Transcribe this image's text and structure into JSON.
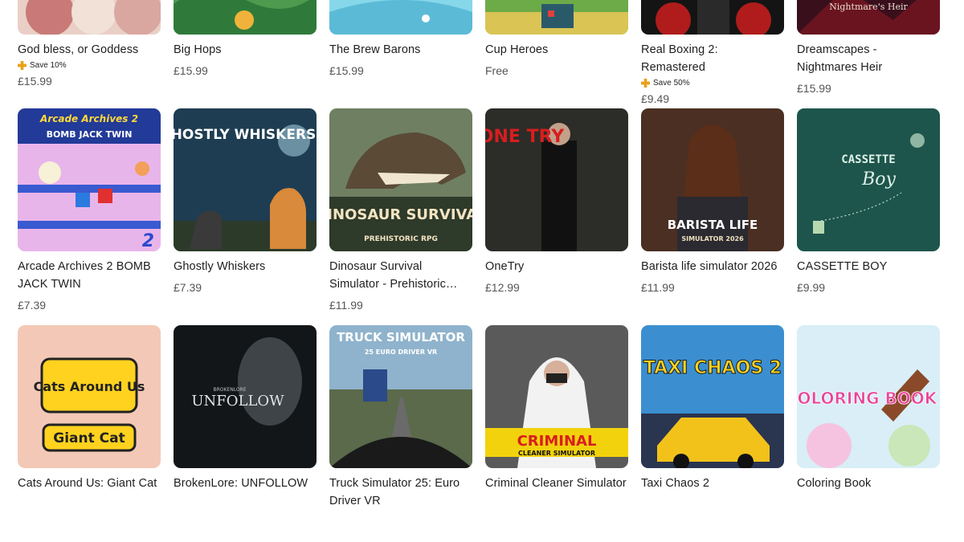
{
  "products": [
    {
      "title": "God bless, or Goddess",
      "promo": "Save 10%",
      "price": "£15.99",
      "art_colors": [
        "#e7c9c0",
        "#b86a6a"
      ]
    },
    {
      "title": "Big Hops",
      "price": "£15.99",
      "art_colors": [
        "#5aa85a",
        "#2f6fa7"
      ]
    },
    {
      "title": "The Brew Barons",
      "price": "£15.99",
      "art_colors": [
        "#7cd3e8",
        "#49b0cf"
      ]
    },
    {
      "title": "Cup Heroes",
      "price": "Free",
      "art_colors": [
        "#6ea84a",
        "#2f5a2a"
      ]
    },
    {
      "title": "Real Boxing 2: Remastered",
      "promo": "Save 50%",
      "price": "£9.49",
      "art_colors": [
        "#1a1a1a",
        "#a01818"
      ]
    },
    {
      "title": "Dreamscapes - Nightmares Heir",
      "price": "£15.99",
      "art_colors": [
        "#5a1010",
        "#2b0c2c"
      ],
      "art_text": "Nightmare's Heir"
    },
    {
      "title": "Arcade Archives 2 BOMB JACK TWIN",
      "price": "£7.39",
      "art_colors": [
        "#2a3f9a",
        "#e3a8e8"
      ],
      "art_text": "Arcade Archives 2",
      "art_subtext": "BOMB JACK TWIN"
    },
    {
      "title": "Ghostly Whiskers",
      "price": "£7.39",
      "art_colors": [
        "#23435a",
        "#0f2431"
      ],
      "art_text": "GHOSTLY WHISKERS"
    },
    {
      "title": "Dinosaur Survival Simulator - Prehistoric RPG",
      "price": "£11.99",
      "art_colors": [
        "#7a8a6a",
        "#3e4a3a"
      ],
      "art_text": "DINOSAUR SURVIVAL",
      "art_subtext": "PREHISTORIC RPG"
    },
    {
      "title": "OneTry",
      "price": "£12.99",
      "art_colors": [
        "#3a3a36",
        "#161614"
      ],
      "art_text": "ONE TRY"
    },
    {
      "title": "Barista life simulator 2026",
      "price": "£11.99",
      "art_colors": [
        "#5a3a2a",
        "#2a1a12"
      ],
      "art_text": "BARISTA LIFE",
      "art_subtext": "SIMULATOR 2026"
    },
    {
      "title": "CASSETTE BOY",
      "price": "£9.99",
      "art_colors": [
        "#1f5a52",
        "#17433d"
      ],
      "art_text": "CASSETTE",
      "art_subtext": "Boy"
    },
    {
      "title": "Cats Around Us: Giant Cat",
      "price": "",
      "art_colors": [
        "#f4c8b6",
        "#e9a88f"
      ],
      "art_text": "Cats Around Us",
      "art_subtext": "Giant Cat"
    },
    {
      "title": "BrokenLore: UNFOLLOW",
      "price": "",
      "art_colors": [
        "#2a2e30",
        "#0e1012"
      ],
      "art_text": "UNFOLLOW",
      "art_subtext": "BROKENLORE"
    },
    {
      "title": "Truck Simulator 25: Euro Driver VR",
      "price": "",
      "art_colors": [
        "#8fb3cc",
        "#3f4a52"
      ],
      "art_text": "TRUCK SIMULATOR",
      "art_subtext": "25 EURO DRIVER VR"
    },
    {
      "title": "Criminal Cleaner Simulator",
      "price": "",
      "art_colors": [
        "#6a6a6a",
        "#2a2a2a"
      ],
      "art_text": "CRIMINAL",
      "art_subtext": "CLEANER SIMULATOR"
    },
    {
      "title": "Taxi Chaos 2",
      "price": "",
      "art_colors": [
        "#4aa0d8",
        "#1d3a6a"
      ],
      "art_text": "TAXI CHAOS 2"
    },
    {
      "title": "Coloring Book",
      "price": "",
      "art_colors": [
        "#bfe3f2",
        "#f5c3e0"
      ],
      "art_text": "COLORING BOOK"
    }
  ]
}
